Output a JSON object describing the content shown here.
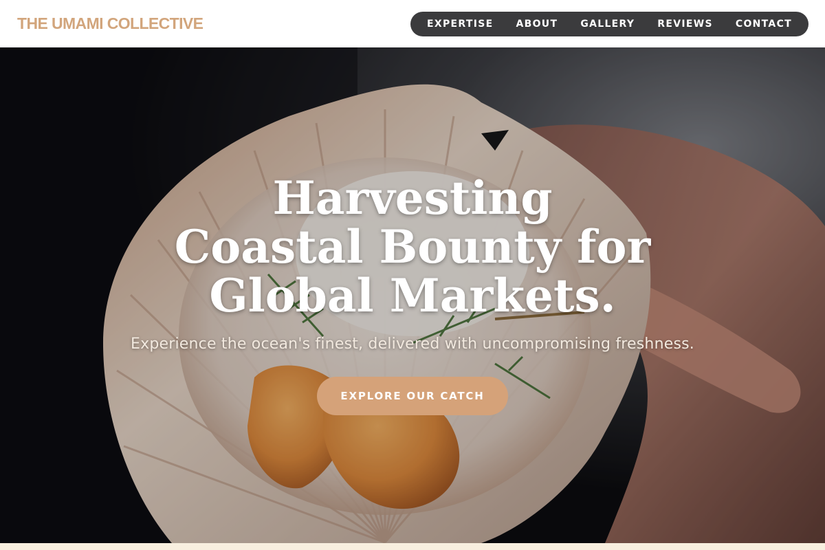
{
  "brand": {
    "name": "THE UMAMI COLLECTIVE",
    "color": "#d2a57c"
  },
  "nav": {
    "items": [
      {
        "label": "EXPERTISE"
      },
      {
        "label": "ABOUT"
      },
      {
        "label": "GALLERY"
      },
      {
        "label": "REVIEWS"
      },
      {
        "label": "CONTACT"
      }
    ],
    "background": "#3b3b3d"
  },
  "hero": {
    "title": "Harvesting Coastal Bounty for Global Markets.",
    "subtitle": "Experience the ocean's finest, delivered with uncompromising freshness.",
    "cta_label": "EXPLORE OUR CATCH",
    "cta_color": "#d5a279",
    "image_subject": "scallop-in-shell-photo"
  }
}
